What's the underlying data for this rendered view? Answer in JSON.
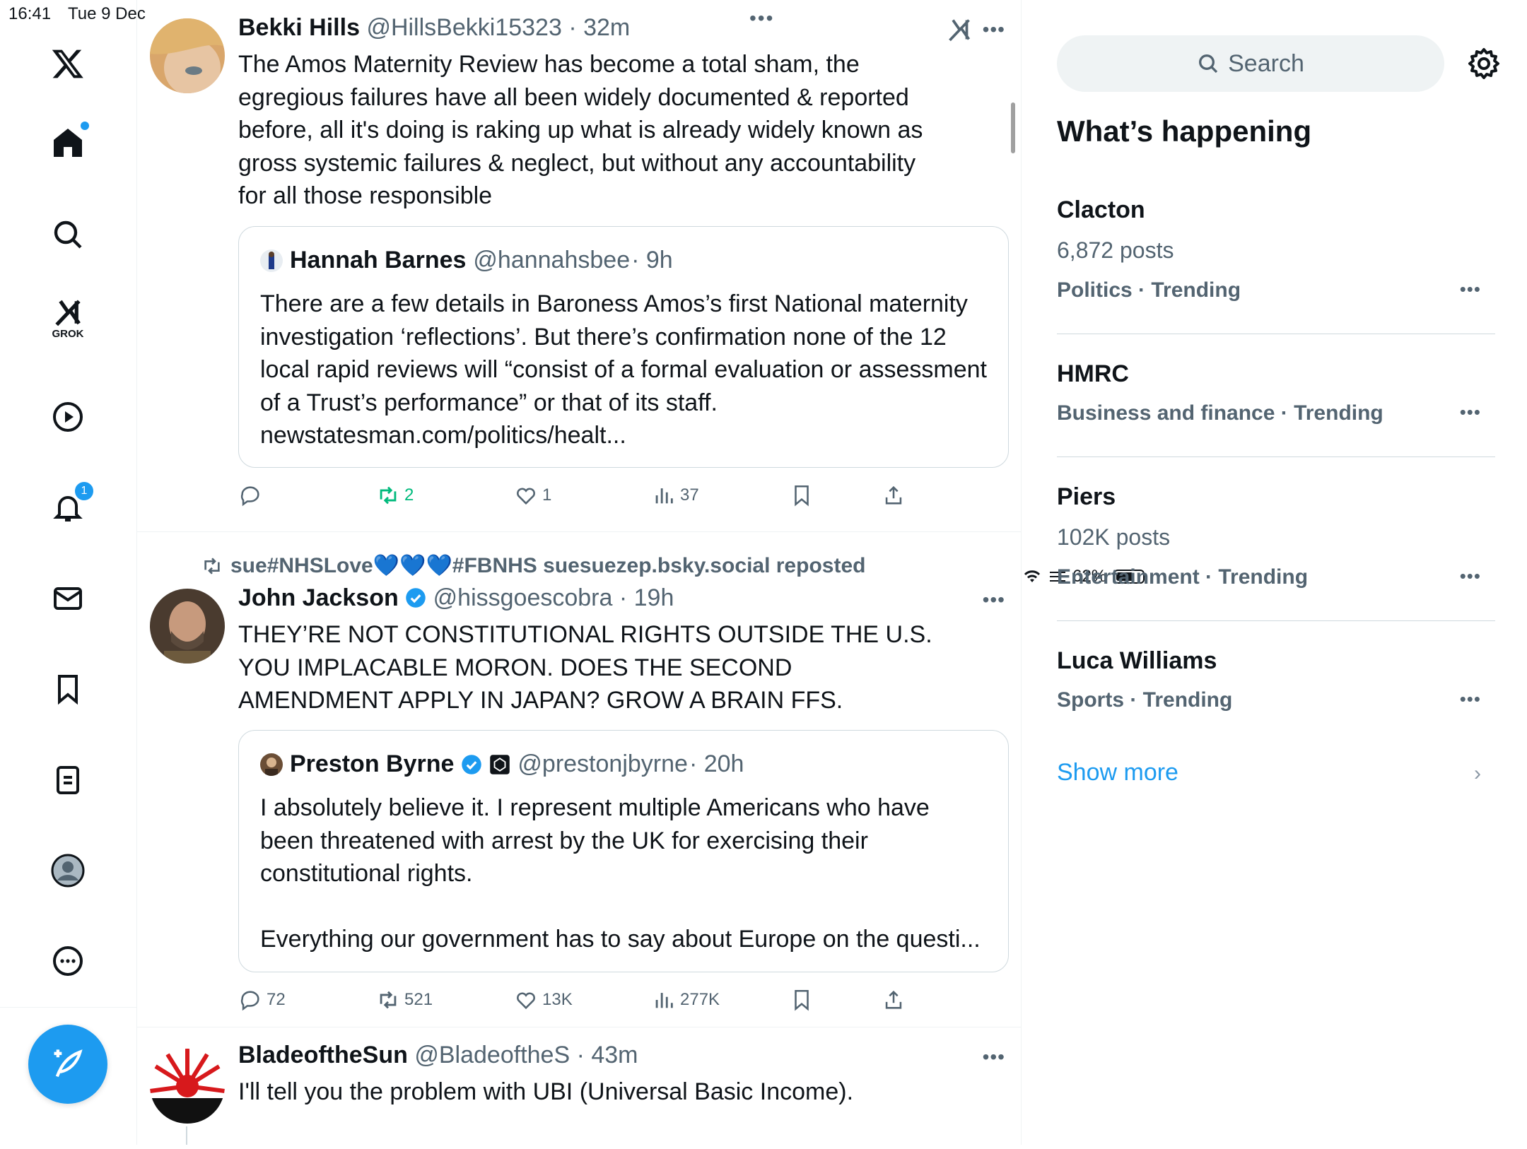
{
  "status_bar": {
    "time": "16:41",
    "date": "Tue 9 Dec",
    "battery": "62%"
  },
  "nav": {
    "grok_label": "GROK",
    "notifications_badge": "1"
  },
  "tweets": [
    {
      "name": "Bekki Hills",
      "handle": "@HillsBekki15323",
      "time": "· 32m",
      "text": "The Amos Maternity Review has become a total sham, the egregious failures have all been widely documented & reported before, all it's doing is raking up what is already widely known as gross systemic failures & neglect, but without any accountability for all those responsible",
      "quote": {
        "name": "Hannah Barnes",
        "handle": "@hannahsbee",
        "time": "· 9h",
        "text": "There are a few details in Baroness Amos’s first National maternity investigation ‘reflections’. But there’s confirmation none of the 12 local rapid reviews will “consist of a formal evaluation or assessment of a Trust’s performance” or that of its staff. newstatesman.com/politics/healt..."
      },
      "stats": {
        "replies": "",
        "reposts": "2",
        "likes": "1",
        "views": "37"
      }
    },
    {
      "repost_by": "sue#NHSLove💙💙💙#FBNHS suesuezep.bsky.social reposted",
      "name": "John Jackson",
      "handle": "@hissgoescobra",
      "time": "· 19h",
      "text": "THEY’RE NOT CONSTITUTIONAL RIGHTS OUTSIDE THE U.S. YOU IMPLACABLE MORON. DOES THE SECOND AMENDMENT  APPLY IN JAPAN? GROW A BRAIN FFS.",
      "quote": {
        "name": "Preston Byrne",
        "handle": "@prestonjbyrne",
        "time": "· 20h",
        "text": "I absolutely believe it. I represent multiple Americans who have been threatened with arrest by the UK for exercising their constitutional rights.",
        "text2": "Everything our government has to say about Europe on the questi..."
      },
      "stats": {
        "replies": "72",
        "reposts": "521",
        "likes": "13K",
        "views": "277K"
      }
    },
    {
      "name": "BladeoftheSun",
      "handle": "@BladeoftheS",
      "time": "· 43m",
      "text": "I'll tell you the problem with UBI (Universal Basic Income)."
    }
  ],
  "sidebar": {
    "search_placeholder": "Search",
    "title": "What’s happening",
    "trends": [
      {
        "name": "Clacton",
        "posts": "6,872 posts",
        "meta": "Politics · Trending"
      },
      {
        "name": "HMRC",
        "posts": "",
        "meta": "Business and finance · Trending"
      },
      {
        "name": "Piers",
        "posts": "102K posts",
        "meta": "Entertainment · Trending"
      },
      {
        "name": "Luca Williams",
        "posts": "",
        "meta": "Sports · Trending"
      }
    ],
    "show_more": "Show more"
  },
  "colors": {
    "accent": "#1d9bf0",
    "repost_green": "#00ba7c",
    "muted": "#536471"
  }
}
